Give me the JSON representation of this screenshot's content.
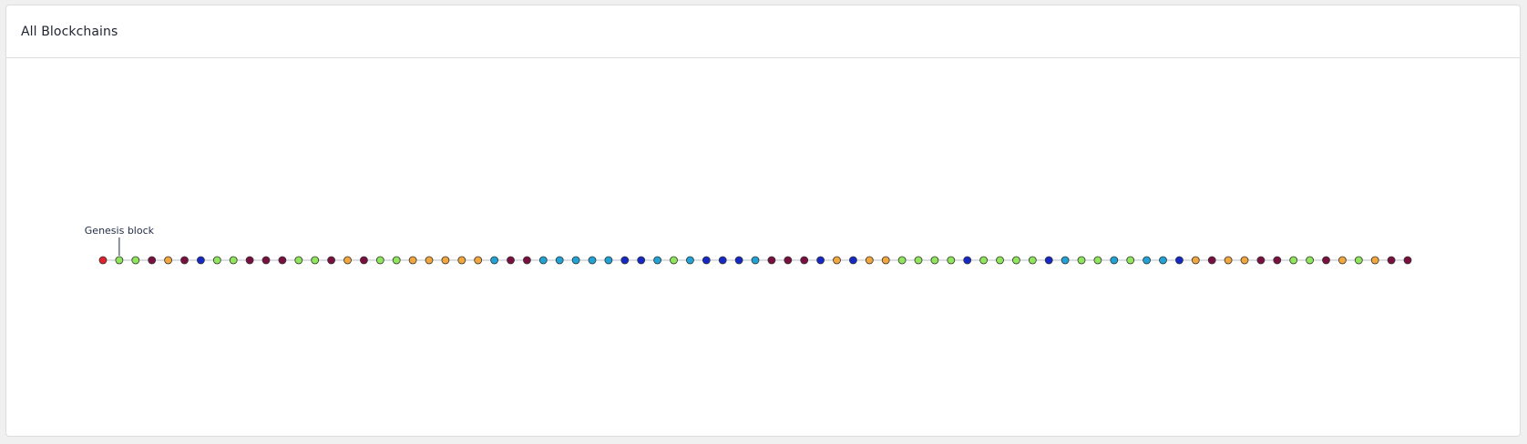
{
  "card": {
    "title": "All Blockchains"
  },
  "annotation": {
    "label": "Genesis block",
    "target_index": 1
  },
  "colors": {
    "red": "#e0202a",
    "green": "#8fe65a",
    "maroon": "#7a0f3f",
    "orange": "#f2a63c",
    "blue": "#1428c8",
    "cyan": "#1fa3d6",
    "link": "#b7bcc4",
    "stroke": "#333333"
  },
  "blocks": [
    "red",
    "green",
    "green",
    "maroon",
    "orange",
    "maroon",
    "blue",
    "green",
    "green",
    "maroon",
    "maroon",
    "maroon",
    "green",
    "green",
    "maroon",
    "orange",
    "maroon",
    "green",
    "green",
    "orange",
    "orange",
    "orange",
    "orange",
    "orange",
    "cyan",
    "maroon",
    "maroon",
    "cyan",
    "cyan",
    "cyan",
    "cyan",
    "cyan",
    "blue",
    "blue",
    "cyan",
    "green",
    "cyan",
    "blue",
    "blue",
    "blue",
    "cyan",
    "maroon",
    "maroon",
    "maroon",
    "blue",
    "orange",
    "blue",
    "orange",
    "orange",
    "green",
    "green",
    "green",
    "green",
    "blue",
    "green",
    "green",
    "green",
    "green",
    "blue",
    "cyan",
    "green",
    "green",
    "cyan",
    "green",
    "cyan",
    "cyan",
    "blue",
    "orange",
    "maroon",
    "orange",
    "orange",
    "maroon",
    "maroon",
    "green",
    "green",
    "maroon",
    "orange",
    "green",
    "orange",
    "maroon",
    "maroon"
  ]
}
